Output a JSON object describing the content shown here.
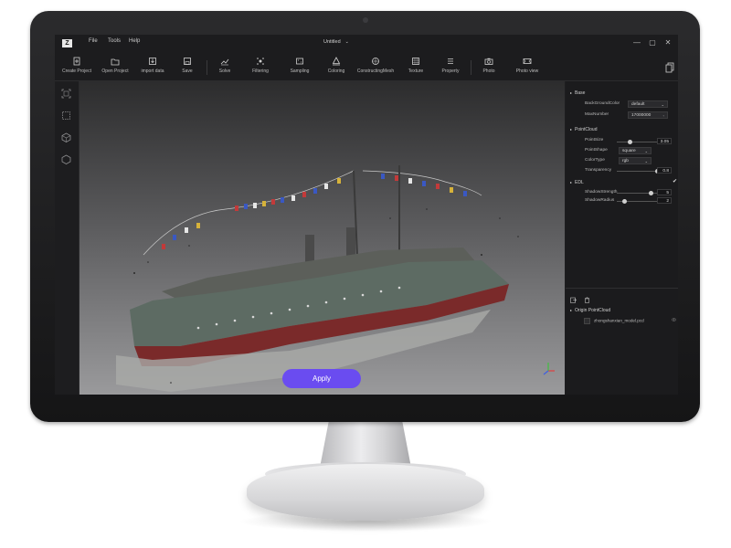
{
  "menu": {
    "file": "File",
    "tools": "Tools",
    "help": "Help"
  },
  "window": {
    "title": "Untitled",
    "title_caret": "⌄",
    "minimize": "—",
    "maximize": "▢",
    "close": "✕"
  },
  "toolbar": {
    "items": [
      {
        "label": "Create Project",
        "icon": "create-project-icon"
      },
      {
        "label": "Open Project",
        "icon": "open-project-icon"
      },
      {
        "label": "import data",
        "icon": "import-data-icon"
      },
      {
        "label": "Save",
        "icon": "save-icon"
      },
      {
        "label": "Solve",
        "icon": "solve-icon"
      },
      {
        "label": "Filtering",
        "icon": "filtering-icon"
      },
      {
        "label": "Sampling",
        "icon": "sampling-icon"
      },
      {
        "label": "Coloring",
        "icon": "coloring-icon"
      },
      {
        "label": "ConstructingMesh",
        "icon": "mesh-icon"
      },
      {
        "label": "Texture",
        "icon": "texture-icon"
      },
      {
        "label": "Property",
        "icon": "property-icon"
      },
      {
        "label": "Photo",
        "icon": "photo-icon"
      },
      {
        "label": "Photo view",
        "icon": "photo-view-icon"
      }
    ]
  },
  "viewport": {
    "apply_label": "Apply"
  },
  "properties": {
    "base": {
      "title": "Base",
      "background_color_label": "BackGroundColor",
      "background_color_value": "default",
      "max_number_label": "MaxNumber",
      "max_number_value": "17000000"
    },
    "point_cloud": {
      "title": "PointCloud",
      "point_size_label": "PointSize",
      "point_size_value": "3.05",
      "point_size_level": 0.25,
      "point_shape_label": "PointShape",
      "point_shape_value": "square",
      "color_type_label": "ColorType",
      "color_type_value": "rgb",
      "transparency_label": "Transparency",
      "transparency_value": "0.8",
      "transparency_level": 0.8
    },
    "edl": {
      "title": "EDL",
      "enabled_mark": "✔",
      "shadow_strength_label": "ShadowStrength",
      "shadow_strength_value": "5",
      "shadow_strength_level": 0.85,
      "shadow_radius_label": "ShadowRadius",
      "shadow_radius_value": "2",
      "shadow_radius_level": 0.2
    }
  },
  "tree": {
    "group_title": "Origin PointCloud",
    "file_name": "zhongshanxian_model.pcd"
  },
  "colors": {
    "accent": "#6a4cf0",
    "hull_red": "#7a2a2a",
    "hull_grey": "#5d6b63"
  }
}
